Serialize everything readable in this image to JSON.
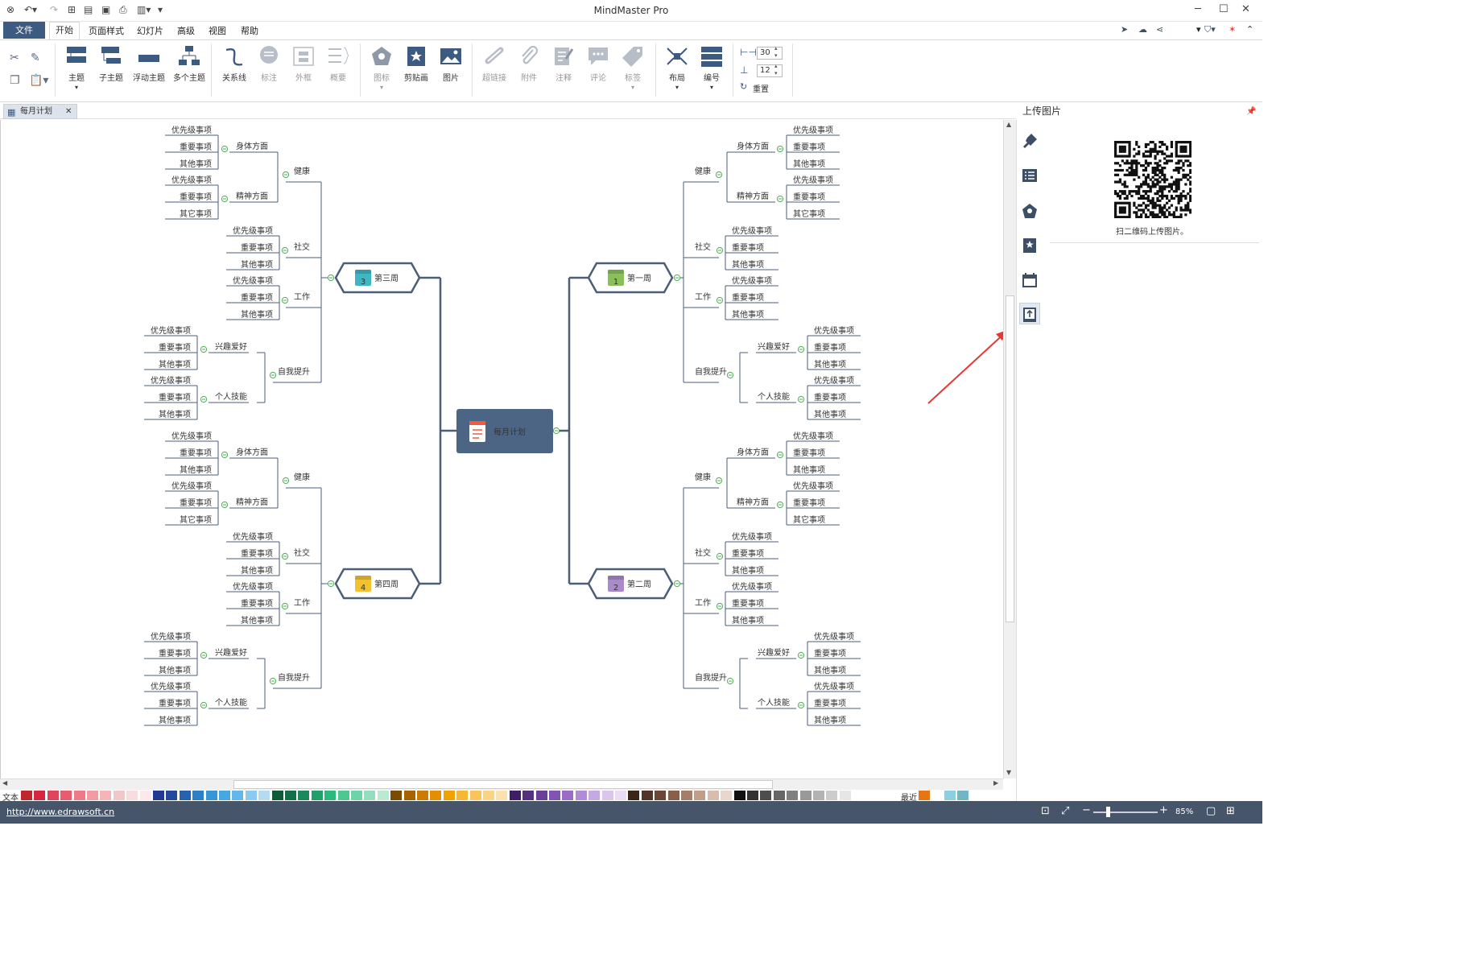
{
  "app_title": "MindMaster Pro",
  "menu": [
    "开始",
    "页面样式",
    "幻灯片",
    "高级",
    "视图",
    "帮助"
  ],
  "menu_file": "文件",
  "ribbon": {
    "topic": "主题",
    "subtopic": "子主题",
    "floating": "浮动主题",
    "multiple": "多个主题",
    "relation": "关系线",
    "callout": "标注",
    "boundary": "外框",
    "summary": "概要",
    "icon": "图标",
    "clipart": "剪贴画",
    "picture": "图片",
    "hyperlink": "超链接",
    "attachment": "附件",
    "note": "注释",
    "comment": "评论",
    "tag": "标签",
    "layout": "布局",
    "numbering": "编号",
    "reset": "重置",
    "spin1": "30",
    "spin2": "12"
  },
  "doc_tab": "每月计划",
  "right_panel": {
    "title": "上传图片",
    "qr_caption": "扫二维码上传图片。"
  },
  "mindmap": {
    "center": "每月计划",
    "week1": {
      "label": "第一周",
      "num": "1",
      "color": "#8bbf5b"
    },
    "week2": {
      "label": "第二周",
      "num": "2",
      "color": "#a98bc9"
    },
    "week3": {
      "label": "第三周",
      "num": "3",
      "color": "#3fb6c4"
    },
    "week4": {
      "label": "第四周",
      "num": "4",
      "color": "#f2c230"
    },
    "health": "健康",
    "social": "社交",
    "work": "工作",
    "self": "自我提升",
    "body": "身体方面",
    "mind": "精神方面",
    "hobby": "兴趣爱好",
    "skill": "个人技能",
    "priority": "优先级事项",
    "important": "重要事项",
    "other": "其他事项",
    "other2": "其它事项"
  },
  "color_label_text": "文本",
  "color_label_recent": "最近",
  "status": {
    "url": "http://www.edrawsoft.cn",
    "zoom": "85%"
  }
}
